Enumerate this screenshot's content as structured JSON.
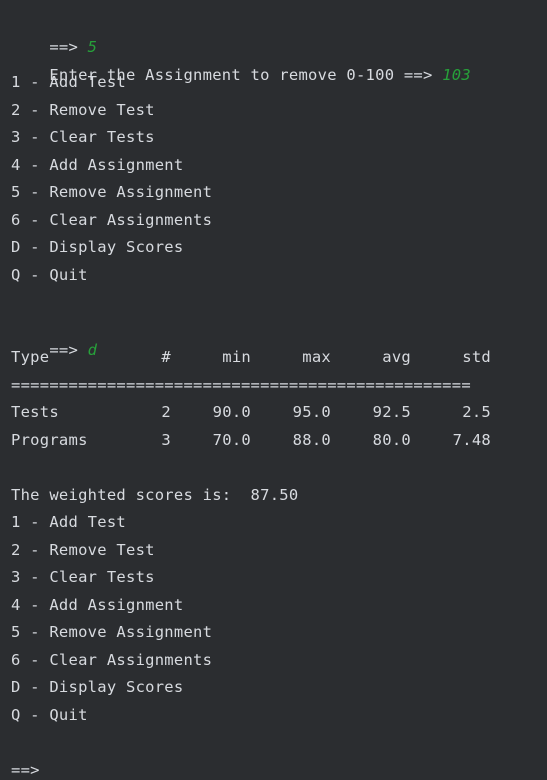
{
  "console": {
    "first_prompt": "==> ",
    "first_input": "5",
    "remove_prompt": "Enter the Assignment to remove 0-100 ==> ",
    "remove_input": "103",
    "menu_first": [
      "1 - Add Test",
      "2 - Remove Test",
      "3 - Clear Tests",
      "4 - Add Assignment",
      "5 - Remove Assignment",
      "6 - Clear Assignments",
      "D - Display Scores",
      "Q - Quit"
    ],
    "second_prompt": "==> ",
    "second_input": "d",
    "table": {
      "headers": [
        "Type",
        "#",
        "min",
        "max",
        "avg",
        "std"
      ],
      "separator": "================================================",
      "rows": [
        [
          "Tests",
          "2",
          "90.0",
          "95.0",
          "92.5",
          "2.5"
        ],
        [
          "Programs",
          "3",
          "70.0",
          "88.0",
          "80.0",
          "7.48"
        ]
      ]
    },
    "weighted_line": "The weighted scores is:  87.50",
    "menu_second": [
      "1 - Add Test",
      "2 - Remove Test",
      "3 - Clear Tests",
      "4 - Add Assignment",
      "5 - Remove Assignment",
      "6 - Clear Assignments",
      "D - Display Scores",
      "Q - Quit"
    ],
    "final_prompt": "==> "
  },
  "colors": {
    "background": "#2b2d30",
    "text": "#d7dadf",
    "user_input": "#27a03a"
  }
}
